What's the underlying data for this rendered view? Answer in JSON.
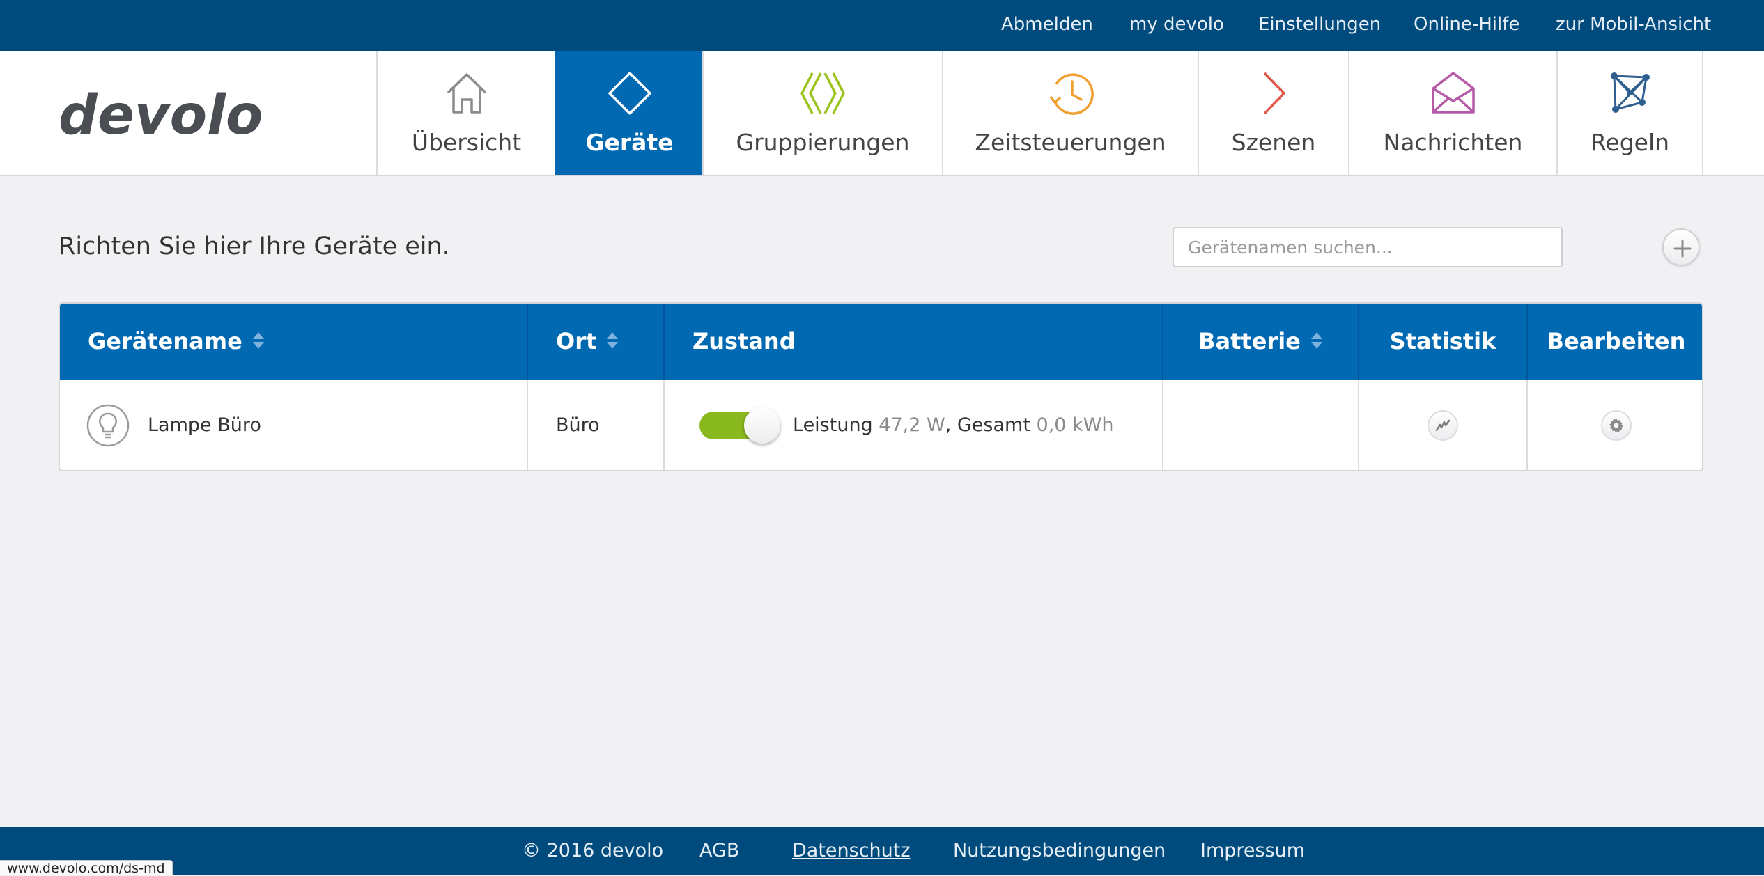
{
  "top_links": [
    "Abmelden",
    "my devolo",
    "Einstellungen",
    "Online-Hilfe",
    "zur Mobil-Ansicht"
  ],
  "brand": {
    "logo_text": "devolo"
  },
  "nav": {
    "tabs": [
      {
        "label": "Übersicht",
        "icon": "home-icon",
        "color": "#8c8c8c",
        "active": false
      },
      {
        "label": "Geräte",
        "icon": "diamond-icon",
        "color": "#ffffff",
        "active": true
      },
      {
        "label": "Gruppierungen",
        "icon": "groups-icon",
        "color": "#9ac31c",
        "active": false
      },
      {
        "label": "Zeitsteuerungen",
        "icon": "clock-icon",
        "color": "#f0a030",
        "active": false
      },
      {
        "label": "Szenen",
        "icon": "play-icon",
        "color": "#e0584a",
        "active": false
      },
      {
        "label": "Nachrichten",
        "icon": "envelope-icon",
        "color": "#b65aa8",
        "active": false
      },
      {
        "label": "Regeln",
        "icon": "network-icon",
        "color": "#2f5f8f",
        "active": false
      }
    ]
  },
  "main": {
    "title": "Richten Sie hier Ihre Geräte ein.",
    "search_placeholder": "Gerätenamen suchen..."
  },
  "table": {
    "columns": [
      "Gerätename",
      "Ort",
      "Zustand",
      "Batterie",
      "Statistik",
      "Bearbeiten"
    ],
    "rows": [
      {
        "name": "Lampe Büro",
        "location": "Büro",
        "switch_on": true,
        "power_label": "Leistung",
        "power_value": "47,2 W",
        "separator": ",",
        "total_label": "Gesamt",
        "total_value": "0,0 kWh",
        "battery": ""
      }
    ]
  },
  "footer": {
    "links": [
      "© 2016 devolo",
      "AGB",
      "Datenschutz",
      "Nutzungsbedingungen",
      "Impressum"
    ]
  },
  "status_url": "www.devolo.com/ds-md",
  "colors": {
    "header_bg": "#004b7d",
    "accent": "#0069b1",
    "toggle_on": "#8ab81f"
  }
}
